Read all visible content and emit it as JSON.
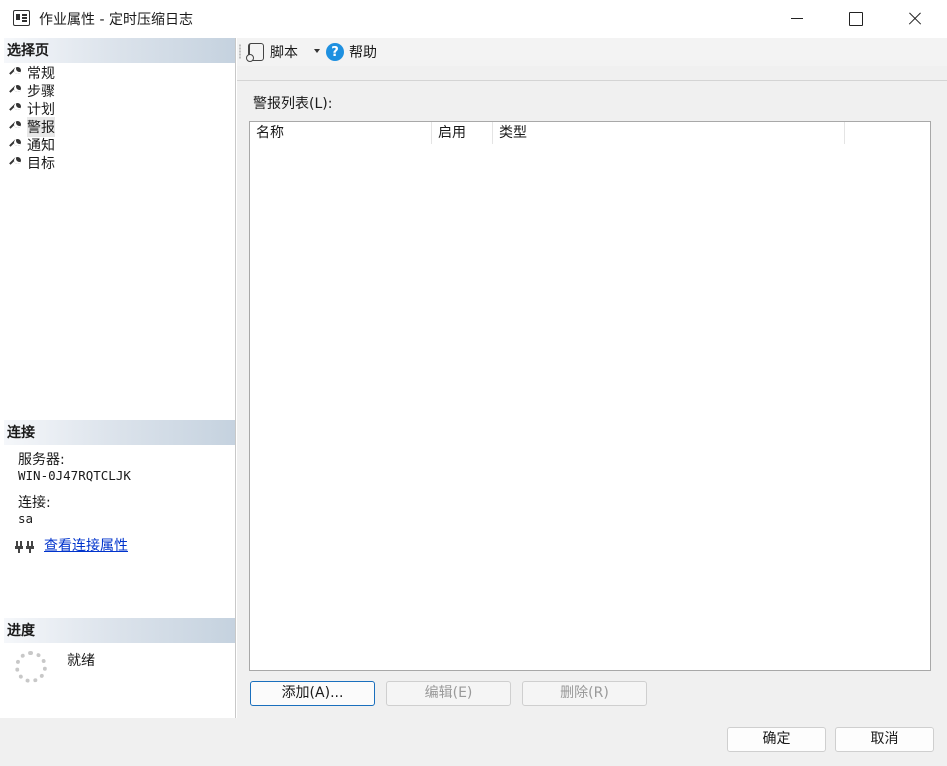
{
  "window": {
    "title": "作业属性 - 定时压缩日志"
  },
  "sidebar": {
    "pages_header": "选择页",
    "items": [
      {
        "label": "常规",
        "icon": "wrench-icon"
      },
      {
        "label": "步骤",
        "icon": "wrench-icon"
      },
      {
        "label": "计划",
        "icon": "wrench-icon"
      },
      {
        "label": "警报",
        "icon": "wrench-icon",
        "selected": true
      },
      {
        "label": "通知",
        "icon": "wrench-icon"
      },
      {
        "label": "目标",
        "icon": "wrench-icon"
      }
    ],
    "connection_header": "连接",
    "server_label": "服务器:",
    "server_value": "WIN-0J47RQTCLJK",
    "connection_label": "连接:",
    "connection_value": "sa",
    "view_connection_link": "查看连接属性",
    "progress_header": "进度",
    "progress_status": "就绪"
  },
  "toolbar": {
    "script_label": "脚本",
    "help_label": "帮助"
  },
  "main": {
    "alert_list_label": "警报列表(L):",
    "columns": [
      "名称",
      "启用",
      "类型"
    ],
    "rows": [],
    "add_button": "添加(A)...",
    "edit_button": "编辑(E)",
    "delete_button": "删除(R)"
  },
  "footer": {
    "ok_button": "确定",
    "cancel_button": "取消"
  }
}
